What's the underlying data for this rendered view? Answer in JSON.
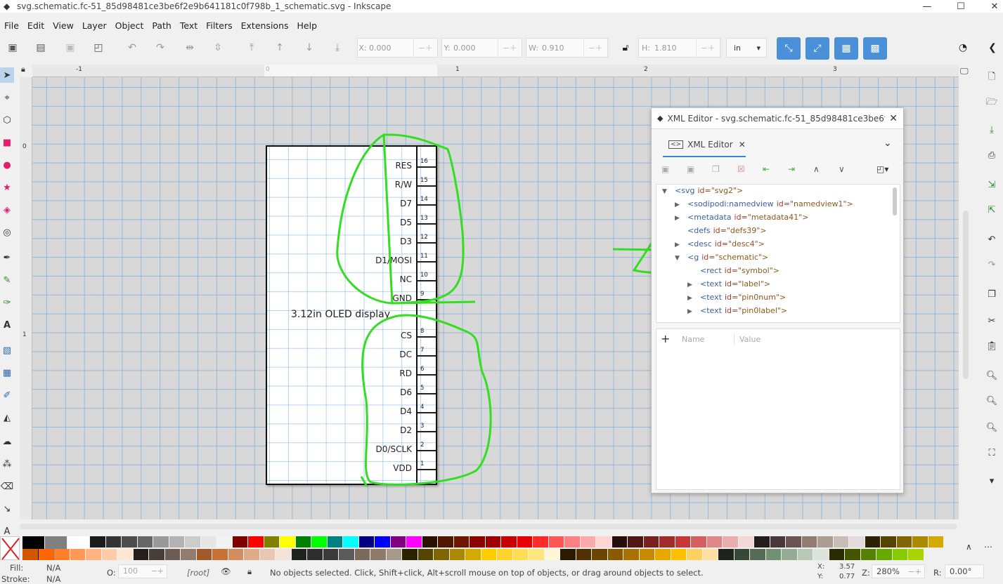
{
  "window": {
    "title": "svg.schematic.fc-51_85d98481ce3be6f2e9b641181c0f798b_1_schematic.svg - Inkscape"
  },
  "menu": [
    "File",
    "Edit",
    "View",
    "Layer",
    "Object",
    "Path",
    "Text",
    "Filters",
    "Extensions",
    "Help"
  ],
  "toolbar": {
    "x_label": "X:",
    "x_value": "0.000",
    "y_label": "Y:",
    "y_value": "0.000",
    "w_label": "W:",
    "w_value": "0.910",
    "h_label": "H:",
    "h_value": "1.810",
    "unit": "in"
  },
  "ruler": {
    "h_labels": [
      "-1",
      "0",
      "1",
      "2",
      "3"
    ],
    "v_labels": [
      "0",
      "1"
    ]
  },
  "canvas": {
    "display_label": "3.12in OLED display",
    "pins": [
      {
        "label": "RES",
        "num": "16"
      },
      {
        "label": "R/W",
        "num": "15"
      },
      {
        "label": "D7",
        "num": "14"
      },
      {
        "label": "D5",
        "num": "13"
      },
      {
        "label": "D3",
        "num": "12"
      },
      {
        "label": "D1/MOSI",
        "num": "11"
      },
      {
        "label": "NC",
        "num": "10"
      },
      {
        "label": "GND",
        "num": "9"
      },
      {
        "label": "CS",
        "num": "8"
      },
      {
        "label": "DC",
        "num": "7"
      },
      {
        "label": "RD",
        "num": "6"
      },
      {
        "label": "D6",
        "num": "5"
      },
      {
        "label": "D4",
        "num": "4"
      },
      {
        "label": "D2",
        "num": "3"
      },
      {
        "label": "D0/SCLK",
        "num": "2"
      },
      {
        "label": "VDD",
        "num": "1"
      }
    ]
  },
  "xml_editor": {
    "title": "XML Editor - svg.schematic.fc-51_85d98481ce3be6f2e9...",
    "tab": "XML Editor",
    "nodes": [
      {
        "tag": "<svg",
        "attr": "id=",
        "val": "\"svg2\">",
        "indent": 0,
        "arrow": "down"
      },
      {
        "tag": "<sodipodi:namedview",
        "attr": "id=",
        "val": "\"namedview1\">",
        "indent": 1,
        "arrow": "right"
      },
      {
        "tag": "<metadata",
        "attr": "id=",
        "val": "\"metadata41\">",
        "indent": 1,
        "arrow": "right"
      },
      {
        "tag": "<defs",
        "attr": "id=",
        "val": "\"defs39\">",
        "indent": 1,
        "arrow": ""
      },
      {
        "tag": "<desc",
        "attr": "id=",
        "val": "\"desc4\">",
        "indent": 1,
        "arrow": "right"
      },
      {
        "tag": "<g",
        "attr": "id=",
        "val": "\"schematic\">",
        "indent": 1,
        "arrow": "down"
      },
      {
        "tag": "<rect",
        "attr": "id=",
        "val": "\"symbol\">",
        "indent": 2,
        "arrow": ""
      },
      {
        "tag": "<text",
        "attr": "id=",
        "val": "\"label\">",
        "indent": 2,
        "arrow": "right"
      },
      {
        "tag": "<text",
        "attr": "id=",
        "val": "\"pin0num\">",
        "indent": 2,
        "arrow": "right"
      },
      {
        "tag": "<text",
        "attr": "id=",
        "val": "\"pin0label\">",
        "indent": 2,
        "arrow": "right"
      }
    ],
    "attr_name_header": "Name",
    "attr_value_header": "Value"
  },
  "status": {
    "fill_label": "Fill:",
    "fill_value": "N/A",
    "stroke_label": "Stroke:",
    "stroke_value": "N/A",
    "opacity_label": "O:",
    "opacity_value": "100",
    "layer": "[root]",
    "message": "No objects selected. Click, Shift+click, Alt+scroll mouse on top of objects, or drag around objects to select.",
    "x_label": "X:",
    "x_value": "3.57",
    "y_label": "Y:",
    "y_value": "0.77",
    "zoom_label": "Z:",
    "zoom_value": "280%",
    "rot_label": "R:",
    "rot_value": "0.00°"
  },
  "palette": {
    "row1": [
      "#000000",
      "#808080",
      "#ffffff",
      "#1a1a1a",
      "#333333",
      "#4d4d4d",
      "#666666",
      "#999999",
      "#b3b3b3",
      "#cccccc",
      "#e6e6e6",
      "#f2f2f2",
      "#800000",
      "#ff0000",
      "#808000",
      "#ffff00",
      "#008000",
      "#00ff00",
      "#008080",
      "#00ffff",
      "#000080",
      "#0000ff",
      "#800080",
      "#ff00ff",
      "#2b1100",
      "#501600",
      "#6c1600",
      "#8b0000",
      "#a00000",
      "#c80000",
      "#e60000",
      "#ff2a2a",
      "#ff5555",
      "#ff8080",
      "#ffaaaa",
      "#ffd5d5",
      "#280b0b",
      "#501616",
      "#782121",
      "#a02c2c",
      "#c83737",
      "#d35f5f",
      "#de8787",
      "#e9afaf",
      "#f4d7d7",
      "#241c1c",
      "#483737",
      "#6c5353",
      "#917c6f",
      "#ac9d93",
      "#c8beb7",
      "#e3dbdb",
      "#2b2200",
      "#554400",
      "#806600",
      "#aa8800",
      "#d4aa00"
    ],
    "row2": [
      "#d45500",
      "#ff6600",
      "#ff7f2a",
      "#ff9955",
      "#ffb380",
      "#ffccaa",
      "#ffe6d5",
      "#241f1c",
      "#483e37",
      "#6c5d53",
      "#917c6f",
      "#a05a2c",
      "#c87137",
      "#d38d5f",
      "#deaa87",
      "#e9c6af",
      "#f4e3d7",
      "#1c241c",
      "#2d2d2d",
      "#3a3a3a",
      "#5a5a5a",
      "#7a6a5a",
      "#8c7b6b",
      "#a89a8a",
      "#2b2200",
      "#554400",
      "#806600",
      "#aa8800",
      "#d4aa00",
      "#ffcc00",
      "#ffd42a",
      "#ffdd55",
      "#ffe680",
      "#fff6d5",
      "#2b1a00",
      "#503000",
      "#6b4400",
      "#8b5a00",
      "#aa7000",
      "#c88a00",
      "#e8a800",
      "#ffbf00",
      "#ffd060",
      "#ffe0a0",
      "#1c241c",
      "#374837",
      "#536c53",
      "#6f916f",
      "#93ac93",
      "#b7c8b7",
      "#dbe3db",
      "#2b2b00",
      "#445500",
      "#558000",
      "#66aa00",
      "#88cc00",
      "#aad400"
    ]
  }
}
